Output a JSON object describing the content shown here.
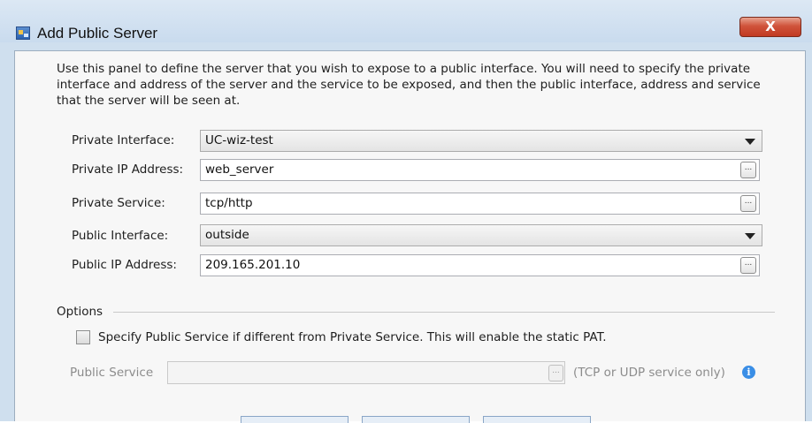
{
  "window": {
    "title": "Add Public Server",
    "close_label": "X"
  },
  "description": "Use this panel to define the server that you wish to expose to a public interface. You will need to specify the private interface and address of the server and the service to be exposed, and then the public interface, address and service that the server will be seen at.",
  "form": {
    "private_interface": {
      "label": "Private Interface:",
      "value": "UC-wiz-test"
    },
    "private_ip": {
      "label": "Private IP Address:",
      "value": "web_server"
    },
    "private_service": {
      "label": "Private Service:",
      "value": "tcp/http"
    },
    "public_interface": {
      "label": "Public Interface:",
      "value": "outside"
    },
    "public_ip": {
      "label": "Public IP Address:",
      "value": "209.165.201.10"
    },
    "browse_label": "..."
  },
  "options": {
    "heading": "Options",
    "checkbox_label": "Specify Public Service if different from Private Service.  This will enable the static PAT.",
    "checkbox_checked": false,
    "public_service_label": "Public Service",
    "public_service_value": "",
    "public_service_hint": "(TCP or UDP service only)",
    "info_glyph": "i"
  },
  "icons": {
    "app": "network-server-icon",
    "info": "info-icon",
    "dropdown": "chevron-down-icon"
  },
  "colors": {
    "close_button": "#c13a22",
    "info": "#3a8ee6"
  }
}
